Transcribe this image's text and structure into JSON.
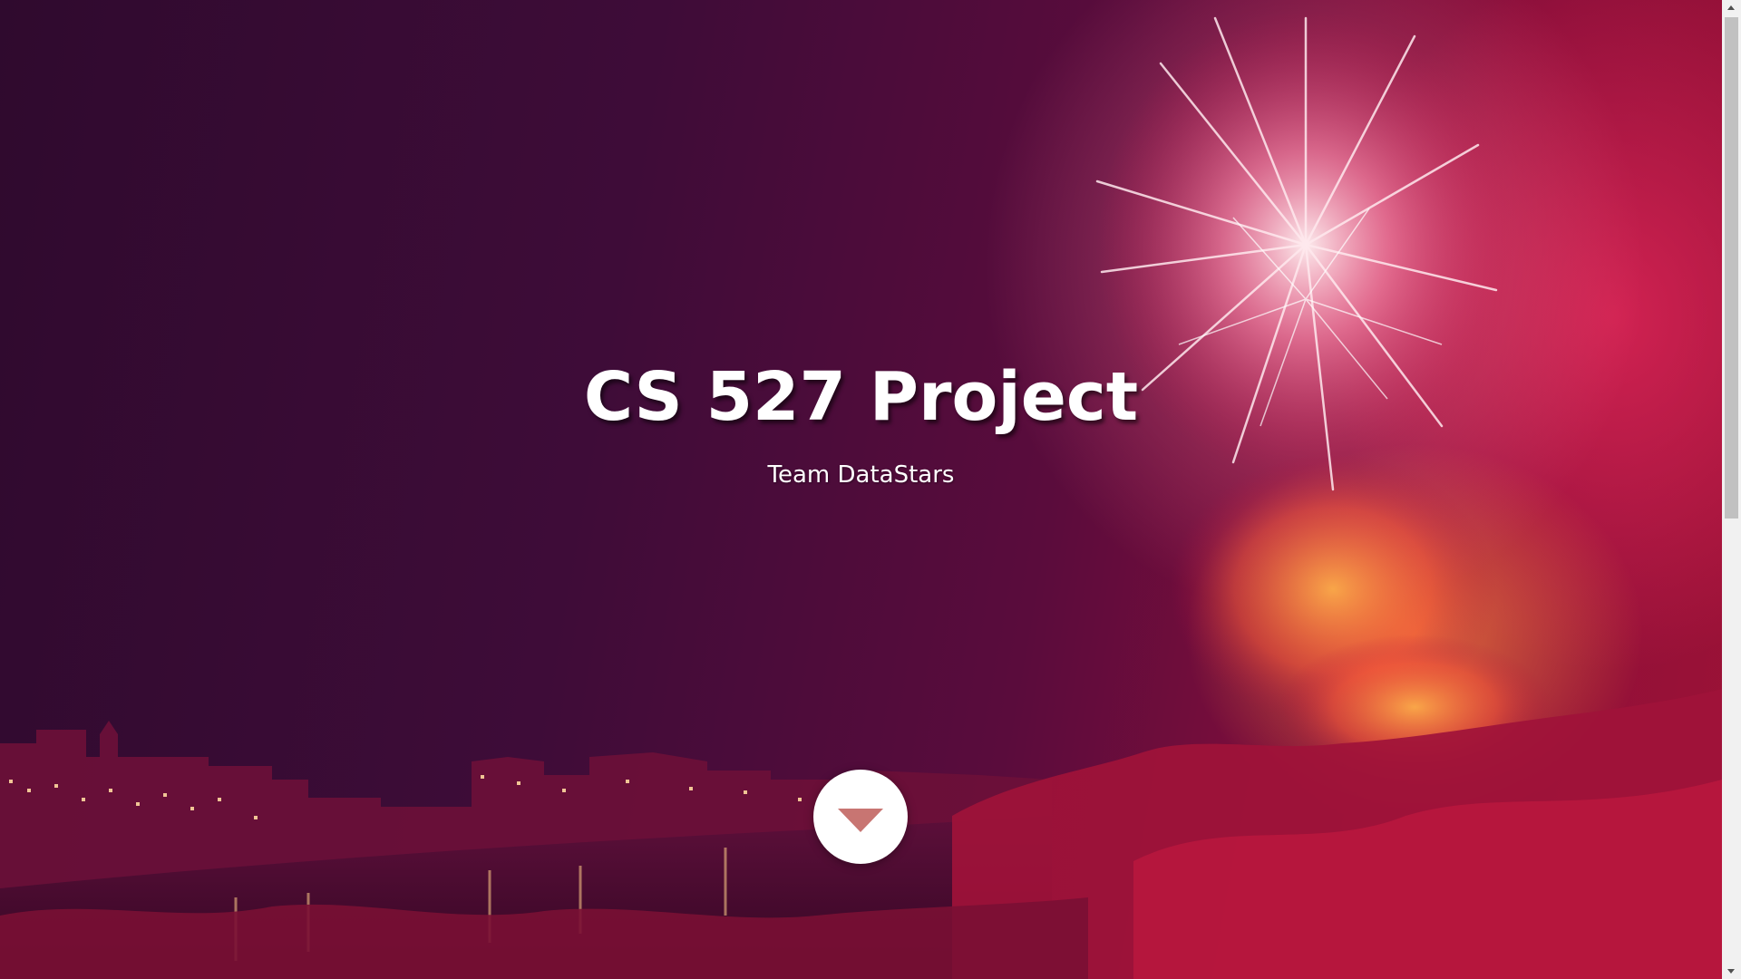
{
  "hero": {
    "title": "CS 527 Project",
    "subtitle": "Team DataStars",
    "background_image": "fireworks over river and town at night"
  },
  "scroll_down_button": {
    "icon": "chevron-down-icon"
  },
  "colors": {
    "accent": "#c87572",
    "button_bg": "#ffffff",
    "title_text": "#ffffff"
  }
}
